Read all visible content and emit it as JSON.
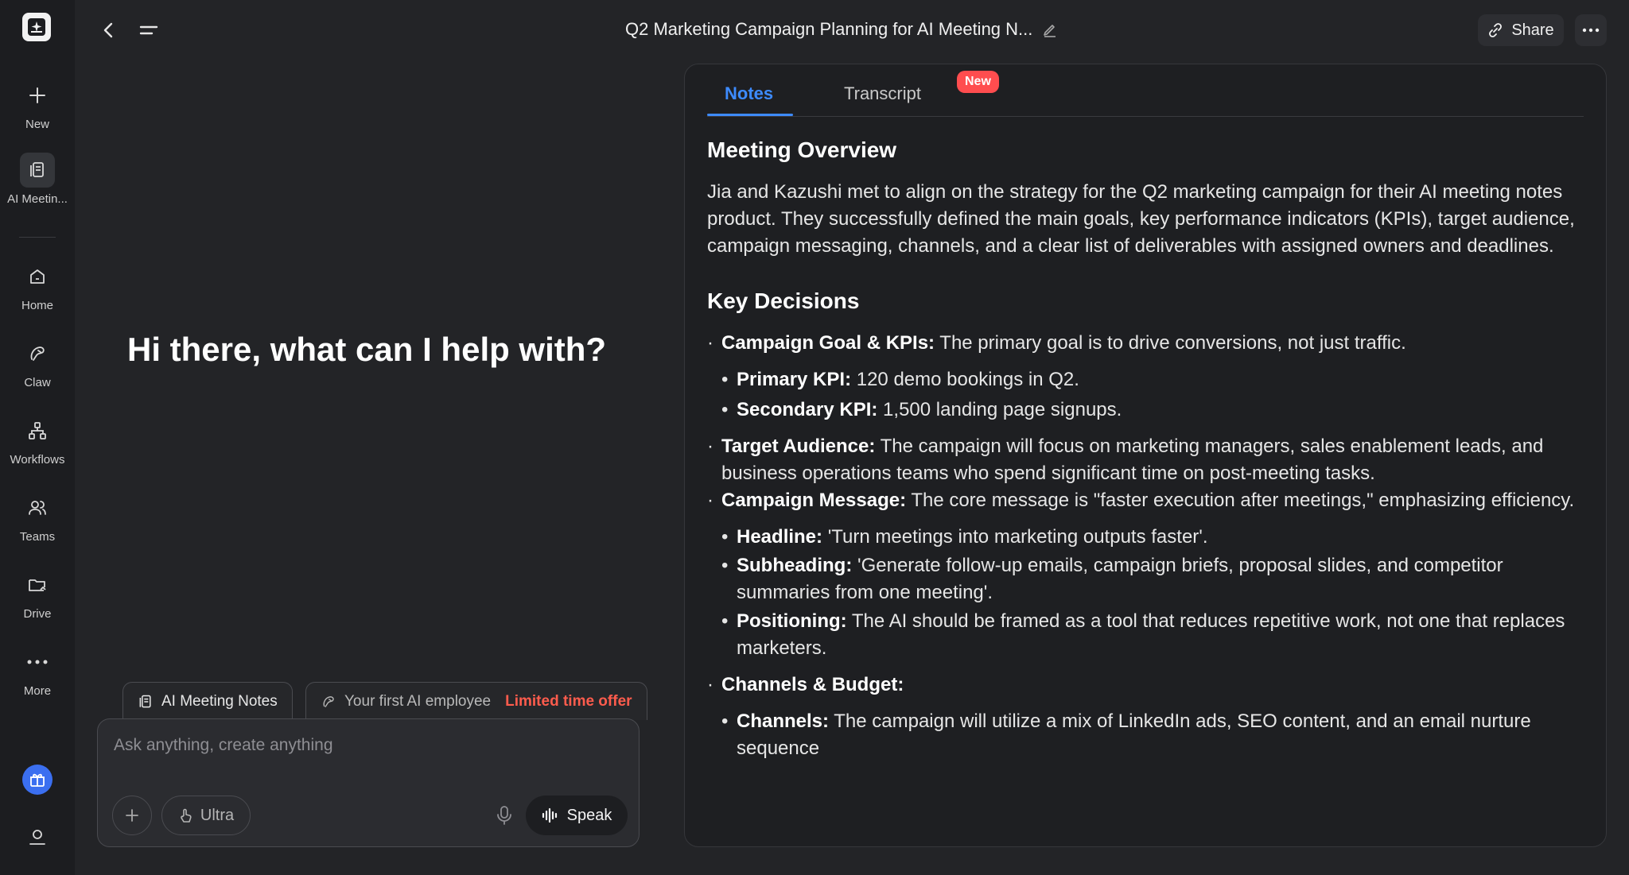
{
  "sidebar": {
    "items": [
      {
        "label": "New",
        "icon": "plus-icon"
      },
      {
        "label": "AI Meetin...",
        "icon": "meeting-notes-icon"
      },
      {
        "label": "Home",
        "icon": "home-icon"
      },
      {
        "label": "Claw",
        "icon": "claw-icon"
      },
      {
        "label": "Workflows",
        "icon": "workflow-icon"
      },
      {
        "label": "Teams",
        "icon": "teams-icon"
      },
      {
        "label": "Drive",
        "icon": "drive-icon"
      },
      {
        "label": "More",
        "icon": "more-dots-icon"
      }
    ]
  },
  "header": {
    "title": "Q2 Marketing Campaign Planning for AI Meeting N...",
    "share_label": "Share"
  },
  "chat": {
    "greeting": "Hi there, what can I help with?",
    "chip_notes": "AI Meeting Notes",
    "chip_employee": "Your first AI employee",
    "chip_offer": "Limited time offer",
    "input_placeholder": "Ask anything, create anything",
    "ultra_label": "Ultra",
    "speak_label": "Speak"
  },
  "panel": {
    "tabs": [
      {
        "label": "Notes",
        "active": true
      },
      {
        "label": "Transcript",
        "active": false,
        "badge": "New"
      }
    ],
    "overview_title": "Meeting Overview",
    "overview_text": "Jia and Kazushi met to align on the strategy for the Q2 marketing campaign for their AI meeting notes product. They successfully defined the main goals, key performance indicators (KPIs), target audience, campaign messaging, channels, and a clear list of deliverables with assigned owners and deadlines.",
    "decisions_title": "Key Decisions",
    "decisions": {
      "goal_label": "Campaign Goal & KPIs:",
      "goal_text": " The primary goal is to drive conversions, not just traffic.",
      "primary_label": "Primary KPI:",
      "primary_text": " 120 demo bookings in Q2.",
      "secondary_label": "Secondary KPI:",
      "secondary_text": " 1,500 landing page signups.",
      "audience_label": "Target Audience:",
      "audience_text": " The campaign will focus on marketing managers, sales enablement leads, and business operations teams who spend significant time on post-meeting tasks.",
      "message_label": "Campaign Message:",
      "message_text": " The core message is \"faster execution after meetings,\" emphasizing efficiency.",
      "headline_label": "Headline:",
      "headline_text": " 'Turn meetings into marketing outputs faster'.",
      "subheading_label": "Subheading:",
      "subheading_text": " 'Generate follow-up emails, campaign briefs, proposal slides, and competitor summaries from one meeting'.",
      "positioning_label": "Positioning:",
      "positioning_text": " The AI should be framed as a tool that reduces repetitive work, not one that replaces marketers.",
      "channels_budget_label": "Channels & Budget:",
      "channels_label": "Channels:",
      "channels_text": " The campaign will utilize a mix of LinkedIn ads, SEO content, and an email nurture sequence"
    }
  },
  "colors": {
    "accent": "#3d8bff",
    "badge": "#ff4d4f",
    "offer": "#ff5c4d",
    "background": "#232427"
  }
}
